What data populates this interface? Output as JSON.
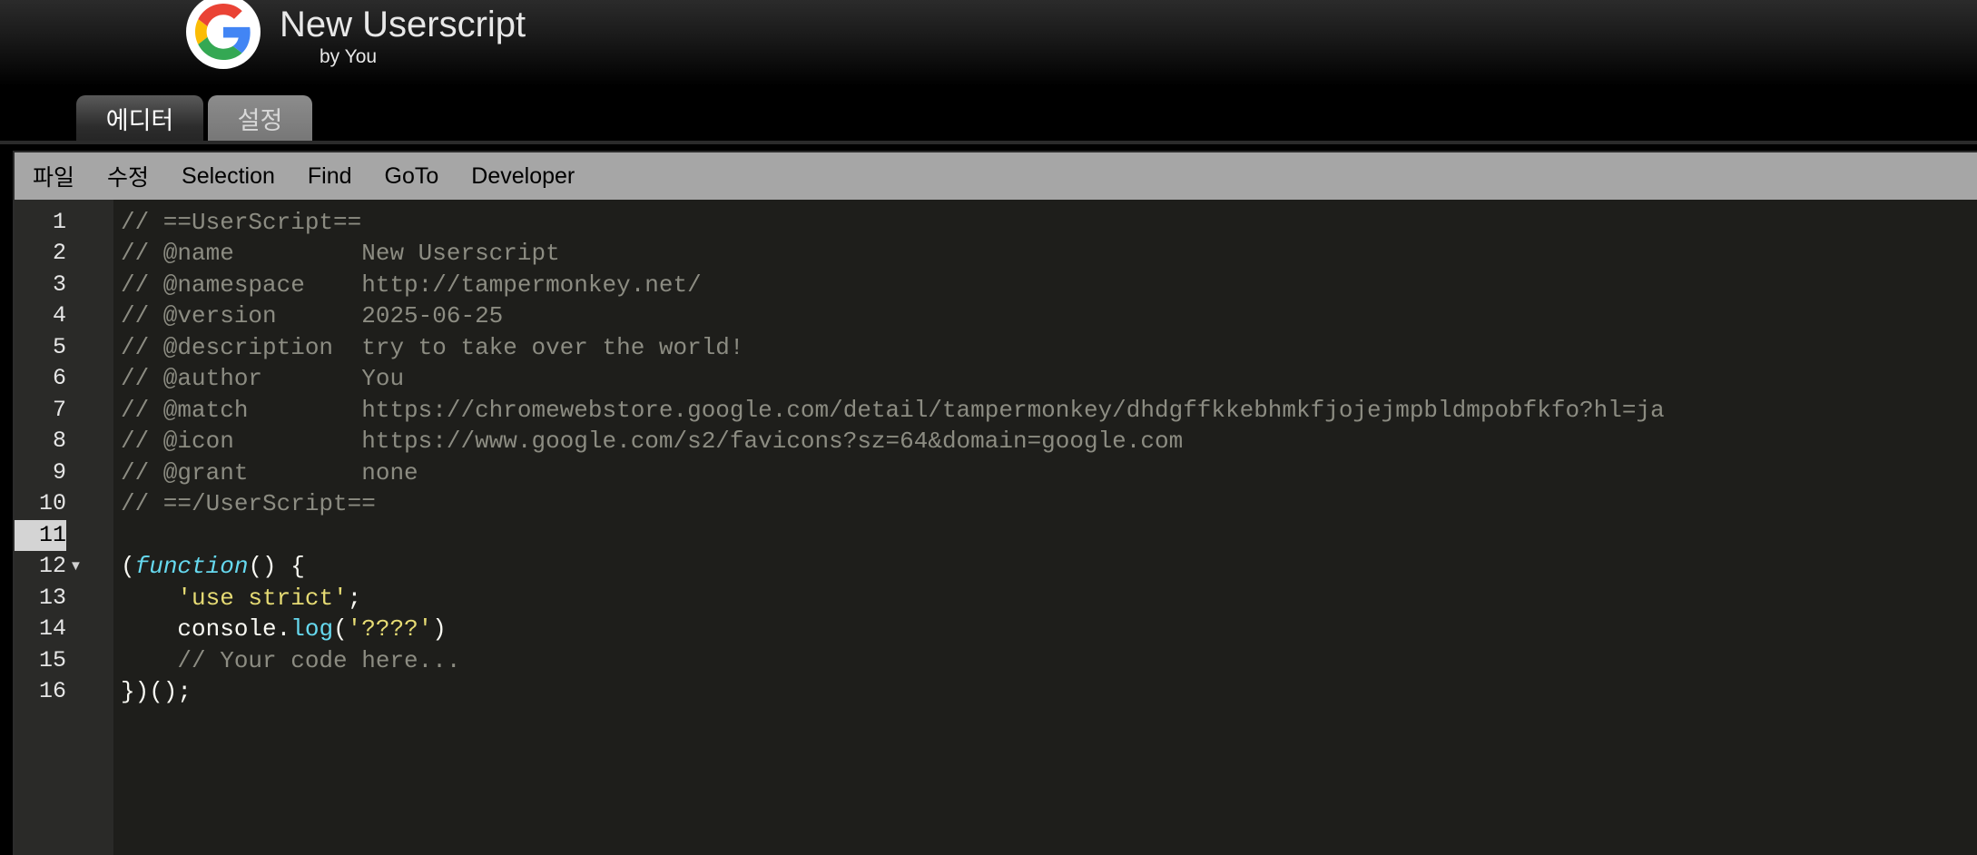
{
  "header": {
    "logo_icon": "google-g-icon",
    "title": "New Userscript",
    "subtitle": "by You"
  },
  "tabs": [
    {
      "label": "에디터",
      "active": true
    },
    {
      "label": "설정",
      "active": false
    }
  ],
  "menu": [
    "파일",
    "수정",
    "Selection",
    "Find",
    "GoTo",
    "Developer"
  ],
  "editor": {
    "active_line": "11",
    "fold_icon": "fold-triangle-icon",
    "fold_glyph": "▼",
    "line_numbers": [
      "1",
      "2",
      "3",
      "4",
      "5",
      "6",
      "7",
      "8",
      "9",
      "10",
      "11",
      "12",
      "13",
      "14",
      "15",
      "16"
    ],
    "lines": {
      "l1": "// ==UserScript==",
      "l2": "// @name         New Userscript",
      "l3": "// @namespace    http://tampermonkey.net/",
      "l4": "// @version      2025-06-25",
      "l5": "// @description  try to take over the world!",
      "l6": "// @author       You",
      "l7": "// @match        https://chromewebstore.google.com/detail/tampermonkey/dhdgffkkebhmkfjojejmpbldmpobfkfo?hl=ja",
      "l8": "// @icon         https://www.google.com/s2/favicons?sz=64&domain=google.com",
      "l9": "// @grant        none",
      "l10": "// ==/UserScript==",
      "l12_open": "(",
      "l12_keyword": "function",
      "l12_rest": "() {",
      "l13_indent": "    ",
      "l13_string": "'use strict'",
      "l13_semi": ";",
      "l14_indent": "    ",
      "l14_obj": "console.",
      "l14_method": "log",
      "l14_paren_open": "(",
      "l14_string": "'????'",
      "l14_paren_close": ")",
      "l15": "    // Your code here...",
      "l16": "})();"
    }
  },
  "colors": {
    "comment": "#8c8c82",
    "keyword": "#66d9ef",
    "string": "#e6db74",
    "code_bg": "#1e1e1b",
    "menubar_bg": "#a6a6a6"
  }
}
